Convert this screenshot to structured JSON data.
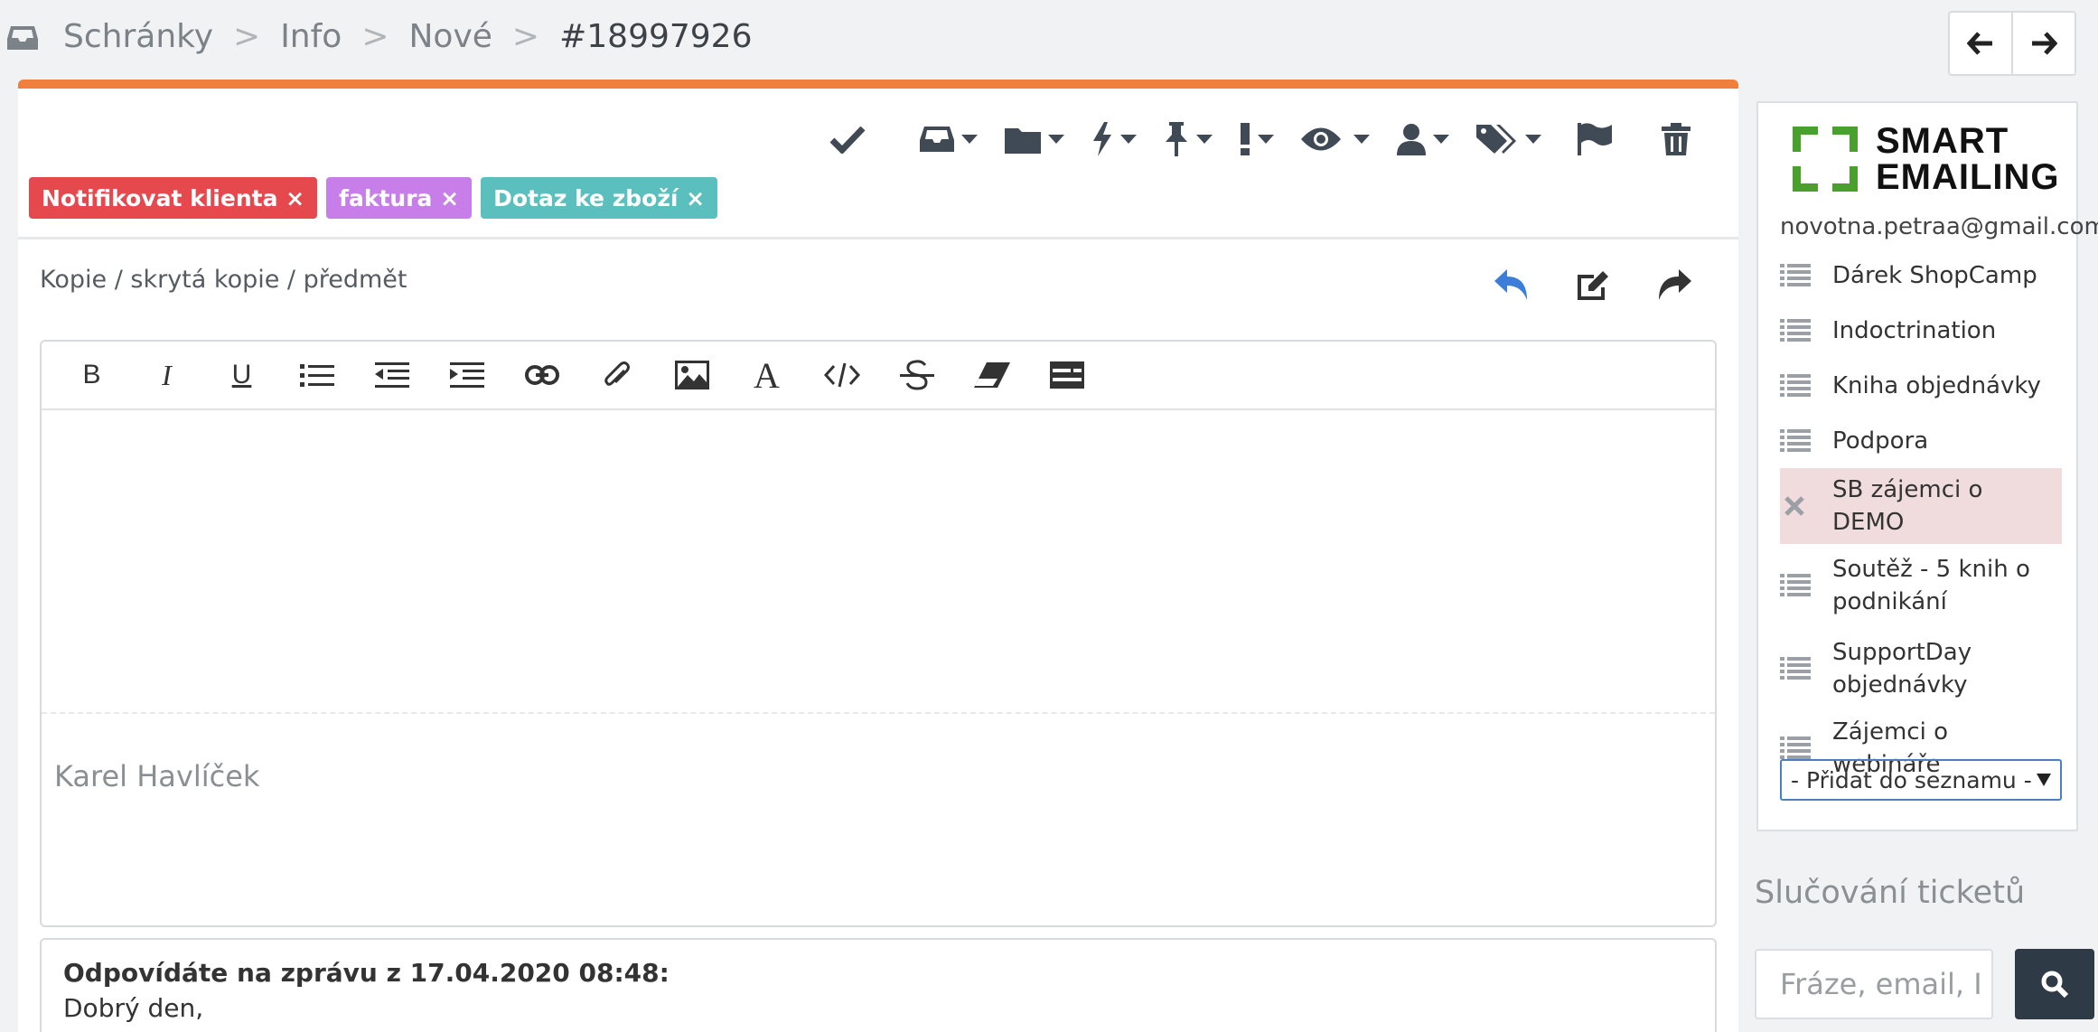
{
  "breadcrumb": {
    "items": [
      "Schránky",
      "Info",
      "Nové"
    ],
    "separator": ">",
    "current": "#18997926"
  },
  "toolbar": {
    "icons": [
      "check-icon",
      "inbox-icon",
      "folder-icon",
      "bolt-icon",
      "pin-icon",
      "exclamation-icon",
      "eye-icon",
      "user-icon",
      "tags-icon",
      "flag-icon",
      "trash-icon"
    ]
  },
  "tags": [
    {
      "label": "Notifikovat klienta ×",
      "color": "#e5484d"
    },
    {
      "label": "faktura ×",
      "color": "#c77ee8"
    },
    {
      "label": "Dotaz ke zboží ×",
      "color": "#5bbfbd"
    }
  ],
  "compose": {
    "cc_link": "Kopie / skrytá kopie / předmět",
    "signature": "Karel Havlíček",
    "editor_buttons": [
      "bold",
      "italic",
      "underline",
      "bulleted-list",
      "outdent",
      "indent",
      "link",
      "attachment",
      "image",
      "font",
      "code",
      "strikethrough",
      "eraser",
      "template"
    ],
    "editor_labels": {
      "bold": "B",
      "italic": "I",
      "underline": "U",
      "font": "A"
    }
  },
  "quoted": {
    "header": "Odpovídáte na zprávu z 17.04.2020 08:48:",
    "first_line": "Dobrý den,"
  },
  "side": {
    "brand_line1": "SMART",
    "brand_line2": "EMAILING",
    "brand_color": "#4aa02c",
    "email": "novotna.petraa@gmail.com",
    "lists": [
      {
        "label": "Dárek ShopCamp",
        "active": false
      },
      {
        "label": "Indoctrination",
        "active": false
      },
      {
        "label": "Kniha objednávky",
        "active": false
      },
      {
        "label": "Podpora",
        "active": false
      },
      {
        "label": "SB zájemci o DEMO",
        "active": true
      },
      {
        "label": "Soutěž - 5 knih o podnikání",
        "active": false
      },
      {
        "label": "SupportDay objednávky",
        "active": false
      },
      {
        "label": "Zájemci o webináře",
        "active": false
      }
    ],
    "add_select": "- Přidat do seznamu -"
  },
  "merge": {
    "title": "Slučování ticketů",
    "placeholder": "Fráze, email, I"
  },
  "colors": {
    "accent": "#ef7f3c",
    "reply_blue": "#3b7dd8",
    "dark": "#2e3a46"
  }
}
